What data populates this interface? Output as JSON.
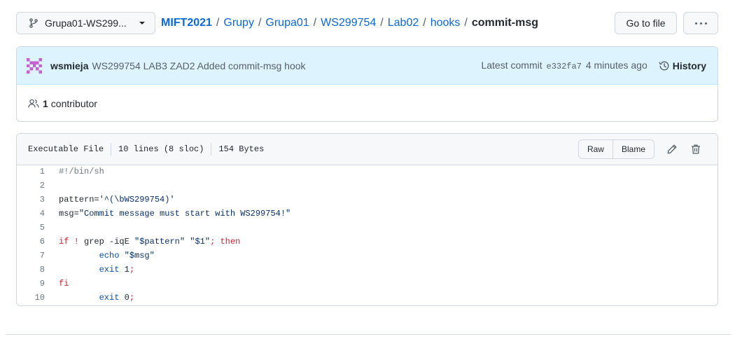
{
  "branch": {
    "name": "Grupa01-WS299..."
  },
  "breadcrumb": {
    "repo": "MIFT2021",
    "parts": [
      "Grupy",
      "Grupa01",
      "WS299754",
      "Lab02",
      "hooks"
    ],
    "file": "commit-msg"
  },
  "buttons": {
    "goto_file": "Go to file"
  },
  "commit": {
    "author": "wsmieja",
    "message": "WS299754 LAB3 ZAD2 Added commit-msg hook",
    "latest_label": "Latest commit",
    "sha": "e332fa7",
    "time": "4 minutes ago",
    "history": "History"
  },
  "contributors": {
    "count": "1",
    "label": "contributor"
  },
  "file": {
    "type": "Executable File",
    "lines": "10 lines (8 sloc)",
    "size": "154 Bytes",
    "raw": "Raw",
    "blame": "Blame"
  },
  "code": [
    {
      "n": "1",
      "parts": [
        {
          "t": "#!/bin/sh",
          "c": "c"
        }
      ]
    },
    {
      "n": "2",
      "parts": []
    },
    {
      "n": "3",
      "parts": [
        {
          "t": "pattern=",
          "c": ""
        },
        {
          "t": "'^(\\bWS299754)'",
          "c": "s"
        }
      ]
    },
    {
      "n": "4",
      "parts": [
        {
          "t": "msg=",
          "c": ""
        },
        {
          "t": "\"Commit message must start with WS299754!\"",
          "c": "s"
        }
      ]
    },
    {
      "n": "5",
      "parts": []
    },
    {
      "n": "6",
      "parts": [
        {
          "t": "if",
          "c": "k"
        },
        {
          "t": " ",
          "c": ""
        },
        {
          "t": "!",
          "c": "k"
        },
        {
          "t": " grep -iqE ",
          "c": ""
        },
        {
          "t": "\"$pattern\"",
          "c": "s"
        },
        {
          "t": " ",
          "c": ""
        },
        {
          "t": "\"$1\"",
          "c": "s"
        },
        {
          "t": ";",
          "c": "k"
        },
        {
          "t": " ",
          "c": ""
        },
        {
          "t": "then",
          "c": "k"
        }
      ]
    },
    {
      "n": "7",
      "parts": [
        {
          "t": "        ",
          "c": ""
        },
        {
          "t": "echo",
          "c": "f"
        },
        {
          "t": " ",
          "c": ""
        },
        {
          "t": "\"$msg\"",
          "c": "s"
        }
      ]
    },
    {
      "n": "8",
      "parts": [
        {
          "t": "        ",
          "c": ""
        },
        {
          "t": "exit",
          "c": "f"
        },
        {
          "t": " 1",
          "c": ""
        },
        {
          "t": ";",
          "c": "k"
        }
      ]
    },
    {
      "n": "9",
      "parts": [
        {
          "t": "fi",
          "c": "k"
        }
      ]
    },
    {
      "n": "10",
      "parts": [
        {
          "t": "        ",
          "c": ""
        },
        {
          "t": "exit",
          "c": "f"
        },
        {
          "t": " 0",
          "c": ""
        },
        {
          "t": ";",
          "c": "k"
        }
      ]
    }
  ],
  "colors": {
    "link": "#0969da",
    "commit_bg": "#ddf4ff",
    "keyword": "#cf222e",
    "string": "#0a3069"
  }
}
